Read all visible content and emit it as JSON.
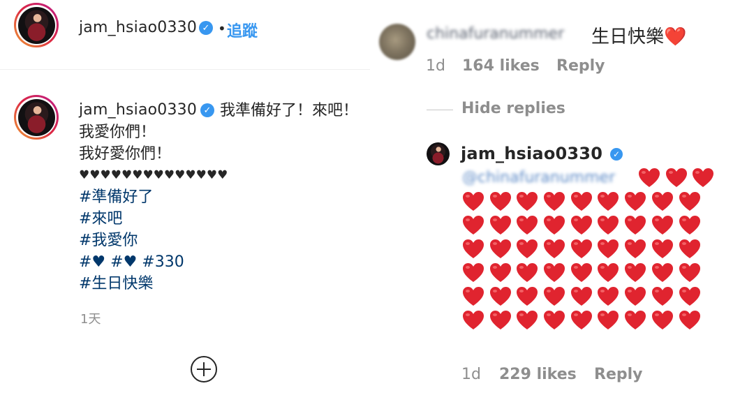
{
  "post": {
    "username": "jam_hsiao0330",
    "follow_label": "追蹤",
    "separator": "•",
    "caption_first_line": "我準備好了！來吧！",
    "caption_lines": [
      "我愛你們！",
      "我好愛你們！"
    ],
    "caption_hearts": "♥♥♥♥♥♥♥♥♥♥♥♥♥♥",
    "hashtags": [
      "#準備好了",
      "#來吧",
      "#我愛你",
      "#♥ #♥ #330",
      "#生日快樂"
    ],
    "time": "1天",
    "add_comment_icon": "plus-circle-icon"
  },
  "comment": {
    "username": "chinafuranummer",
    "text": "生日快樂❤️",
    "time": "1d",
    "likes": "164 likes",
    "reply_label": "Reply",
    "hide_replies_label": "Hide replies"
  },
  "reply": {
    "username": "jam_hsiao0330",
    "mention": "@chinafuranummer",
    "heart_count": 57,
    "time": "1d",
    "likes": "229 likes",
    "reply_label": "Reply"
  },
  "colors": {
    "link_blue": "#3897f0",
    "hashtag_blue": "#00376b",
    "meta_gray": "#8e8e8e",
    "heart_red": "#e0242f"
  }
}
